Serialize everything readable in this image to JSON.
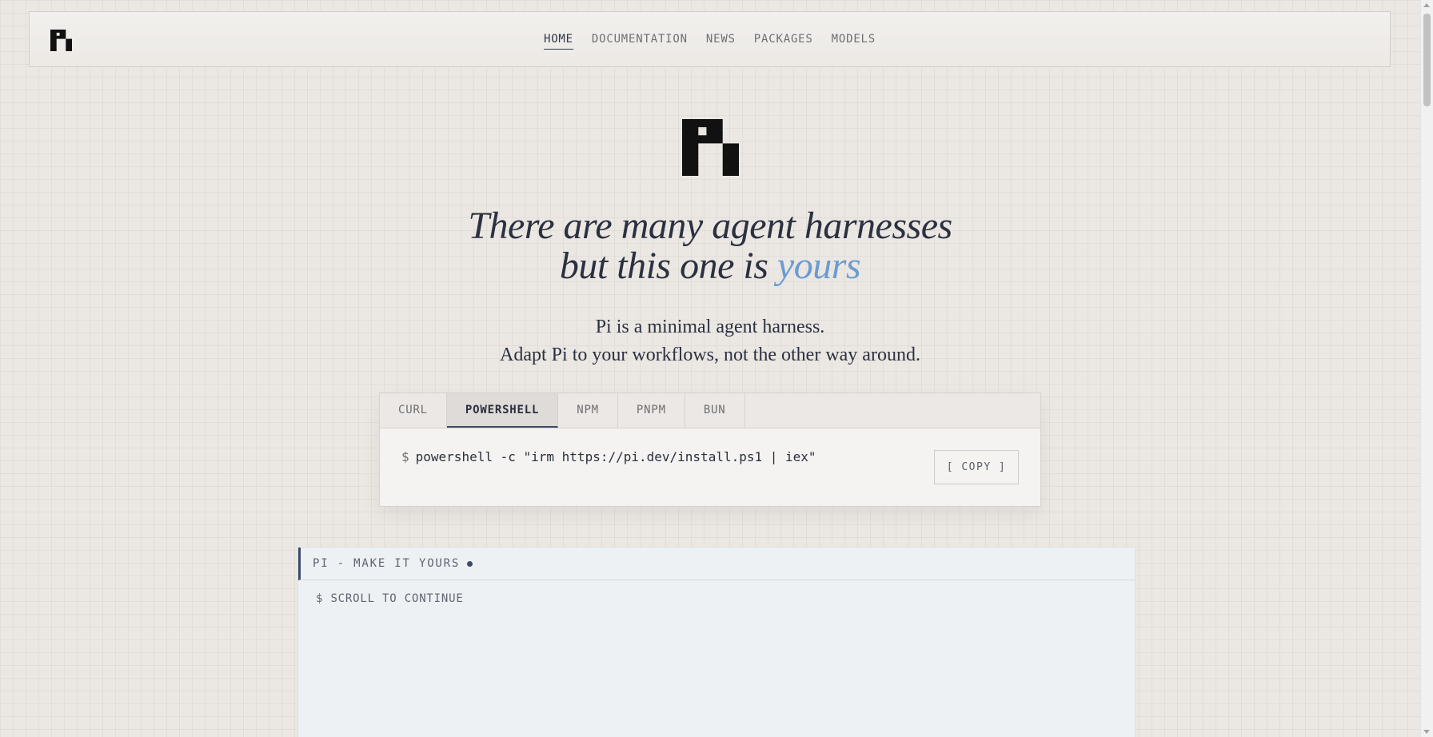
{
  "header": {
    "logo_icon": "pi-logo-icon",
    "nav": [
      {
        "label": "HOME",
        "active": true
      },
      {
        "label": "DOCUMENTATION",
        "active": false
      },
      {
        "label": "NEWS",
        "active": false
      },
      {
        "label": "PACKAGES",
        "active": false
      },
      {
        "label": "MODELS",
        "active": false
      }
    ]
  },
  "hero": {
    "headline_line1": "There are many agent harnesses",
    "headline_line2_prefix": "but this one is ",
    "headline_accent": "yours",
    "sub_line1": "Pi is a minimal agent harness.",
    "sub_line2": "Adapt Pi to your workflows, not the other way around."
  },
  "install": {
    "tabs": [
      {
        "label": "CURL",
        "active": false
      },
      {
        "label": "POWERSHELL",
        "active": true
      },
      {
        "label": "NPM",
        "active": false
      },
      {
        "label": "PNPM",
        "active": false
      },
      {
        "label": "BUN",
        "active": false
      }
    ],
    "prompt": "$",
    "command": "powershell -c \"irm https://pi.dev/install.ps1 | iex\"",
    "copy_label": "[ COPY ]"
  },
  "terminal": {
    "title": "PI - MAKE IT YOURS",
    "body": "$ SCROLL TO CONTINUE"
  },
  "colors": {
    "accent": "#6b9bd0",
    "ink": "#2b3140",
    "active_tab_border": "#3c4b66"
  }
}
